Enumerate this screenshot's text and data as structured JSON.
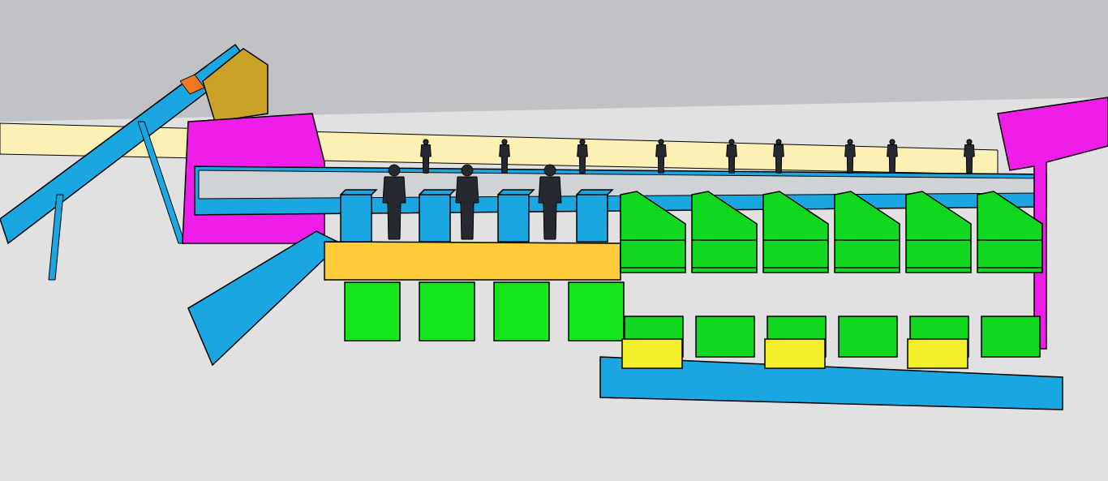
{
  "bins": [
    {
      "kind": "chute"
    },
    {
      "kind": "chute"
    },
    {
      "kind": "chute"
    },
    {
      "kind": "chute"
    },
    {
      "kind": "box"
    },
    {
      "kind": "box"
    },
    {
      "kind": "box"
    },
    {
      "kind": "box"
    },
    {
      "kind": "hopper"
    },
    {
      "kind": "hopper"
    },
    {
      "kind": "hopper"
    },
    {
      "kind": "hopper"
    },
    {
      "kind": "hopper"
    },
    {
      "kind": "hopper"
    }
  ]
}
